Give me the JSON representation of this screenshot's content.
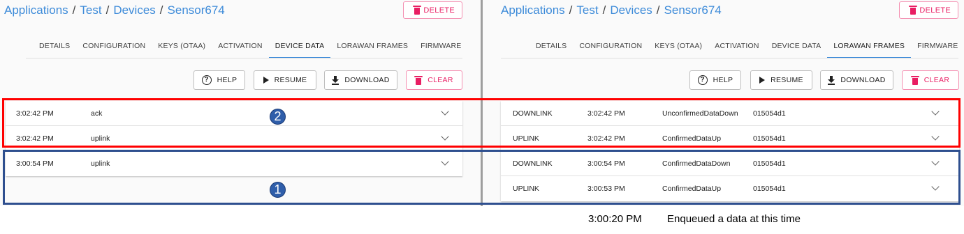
{
  "breadcrumb": {
    "apps": "Applications",
    "app": "Test",
    "devices": "Devices",
    "device": "Sensor674",
    "separator": "/"
  },
  "delete_label": "DELETE",
  "tabs": [
    "DETAILS",
    "CONFIGURATION",
    "KEYS (OTAA)",
    "ACTIVATION",
    "DEVICE DATA",
    "LORAWAN FRAMES",
    "FIRMWARE"
  ],
  "toolbar": {
    "help": "HELP",
    "resume": "RESUME",
    "download": "DOWNLOAD",
    "clear": "CLEAR",
    "help_glyph": "?"
  },
  "device_data": {
    "rows": [
      {
        "time": "3:02:42 PM",
        "event": "ack"
      },
      {
        "time": "3:02:42 PM",
        "event": "uplink"
      },
      {
        "time": "3:00:54 PM",
        "event": "uplink"
      }
    ]
  },
  "lorawan_frames": {
    "rows": [
      {
        "direction": "DOWNLINK",
        "time": "3:02:42 PM",
        "type": "UnconfirmedDataDown",
        "dev_addr": "015054d1"
      },
      {
        "direction": "UPLINK",
        "time": "3:02:42 PM",
        "type": "ConfirmedDataUp",
        "dev_addr": "015054d1"
      },
      {
        "direction": "DOWNLINK",
        "time": "3:00:54 PM",
        "type": "ConfirmedDataDown",
        "dev_addr": "015054d1"
      },
      {
        "direction": "UPLINK",
        "time": "3:00:53 PM",
        "type": "ConfirmedDataUp",
        "dev_addr": "015054d1"
      }
    ]
  },
  "annotations": {
    "badge_1": "1",
    "badge_2": "2",
    "note_time": "3:00:20 PM",
    "note_text": "Enqueued a data at this time"
  },
  "colors": {
    "link": "#3d8bd9",
    "danger": "#e91e63",
    "red_box": "#ff0000",
    "blue_box": "#2e4f8f",
    "badge": "#2f5eaa"
  }
}
